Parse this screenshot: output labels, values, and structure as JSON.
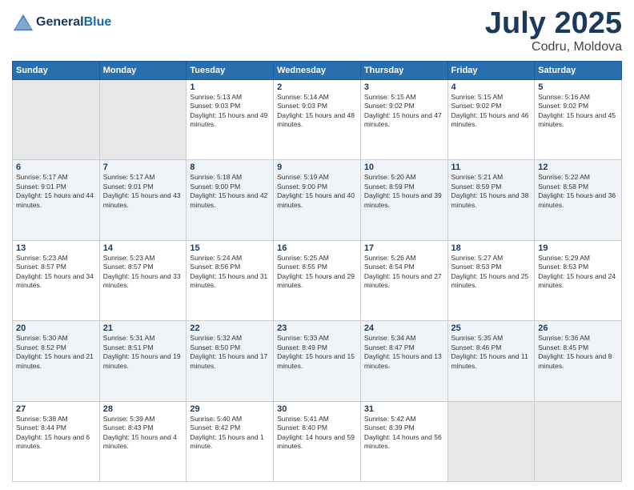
{
  "header": {
    "logo_general": "General",
    "logo_blue": "Blue",
    "month_year": "July 2025",
    "location": "Codru, Moldova"
  },
  "days_of_week": [
    "Sunday",
    "Monday",
    "Tuesday",
    "Wednesday",
    "Thursday",
    "Friday",
    "Saturday"
  ],
  "weeks": [
    [
      {
        "day": "",
        "info": ""
      },
      {
        "day": "",
        "info": ""
      },
      {
        "day": "1",
        "info": "Sunrise: 5:13 AM\nSunset: 9:03 PM\nDaylight: 15 hours and 49 minutes."
      },
      {
        "day": "2",
        "info": "Sunrise: 5:14 AM\nSunset: 9:03 PM\nDaylight: 15 hours and 48 minutes."
      },
      {
        "day": "3",
        "info": "Sunrise: 5:15 AM\nSunset: 9:02 PM\nDaylight: 15 hours and 47 minutes."
      },
      {
        "day": "4",
        "info": "Sunrise: 5:15 AM\nSunset: 9:02 PM\nDaylight: 15 hours and 46 minutes."
      },
      {
        "day": "5",
        "info": "Sunrise: 5:16 AM\nSunset: 9:02 PM\nDaylight: 15 hours and 45 minutes."
      }
    ],
    [
      {
        "day": "6",
        "info": "Sunrise: 5:17 AM\nSunset: 9:01 PM\nDaylight: 15 hours and 44 minutes."
      },
      {
        "day": "7",
        "info": "Sunrise: 5:17 AM\nSunset: 9:01 PM\nDaylight: 15 hours and 43 minutes."
      },
      {
        "day": "8",
        "info": "Sunrise: 5:18 AM\nSunset: 9:00 PM\nDaylight: 15 hours and 42 minutes."
      },
      {
        "day": "9",
        "info": "Sunrise: 5:19 AM\nSunset: 9:00 PM\nDaylight: 15 hours and 40 minutes."
      },
      {
        "day": "10",
        "info": "Sunrise: 5:20 AM\nSunset: 8:59 PM\nDaylight: 15 hours and 39 minutes."
      },
      {
        "day": "11",
        "info": "Sunrise: 5:21 AM\nSunset: 8:59 PM\nDaylight: 15 hours and 38 minutes."
      },
      {
        "day": "12",
        "info": "Sunrise: 5:22 AM\nSunset: 8:58 PM\nDaylight: 15 hours and 36 minutes."
      }
    ],
    [
      {
        "day": "13",
        "info": "Sunrise: 5:23 AM\nSunset: 8:57 PM\nDaylight: 15 hours and 34 minutes."
      },
      {
        "day": "14",
        "info": "Sunrise: 5:23 AM\nSunset: 8:57 PM\nDaylight: 15 hours and 33 minutes."
      },
      {
        "day": "15",
        "info": "Sunrise: 5:24 AM\nSunset: 8:56 PM\nDaylight: 15 hours and 31 minutes."
      },
      {
        "day": "16",
        "info": "Sunrise: 5:25 AM\nSunset: 8:55 PM\nDaylight: 15 hours and 29 minutes."
      },
      {
        "day": "17",
        "info": "Sunrise: 5:26 AM\nSunset: 8:54 PM\nDaylight: 15 hours and 27 minutes."
      },
      {
        "day": "18",
        "info": "Sunrise: 5:27 AM\nSunset: 8:53 PM\nDaylight: 15 hours and 25 minutes."
      },
      {
        "day": "19",
        "info": "Sunrise: 5:29 AM\nSunset: 8:53 PM\nDaylight: 15 hours and 24 minutes."
      }
    ],
    [
      {
        "day": "20",
        "info": "Sunrise: 5:30 AM\nSunset: 8:52 PM\nDaylight: 15 hours and 21 minutes."
      },
      {
        "day": "21",
        "info": "Sunrise: 5:31 AM\nSunset: 8:51 PM\nDaylight: 15 hours and 19 minutes."
      },
      {
        "day": "22",
        "info": "Sunrise: 5:32 AM\nSunset: 8:50 PM\nDaylight: 15 hours and 17 minutes."
      },
      {
        "day": "23",
        "info": "Sunrise: 5:33 AM\nSunset: 8:49 PM\nDaylight: 15 hours and 15 minutes."
      },
      {
        "day": "24",
        "info": "Sunrise: 5:34 AM\nSunset: 8:47 PM\nDaylight: 15 hours and 13 minutes."
      },
      {
        "day": "25",
        "info": "Sunrise: 5:35 AM\nSunset: 8:46 PM\nDaylight: 15 hours and 11 minutes."
      },
      {
        "day": "26",
        "info": "Sunrise: 5:36 AM\nSunset: 8:45 PM\nDaylight: 15 hours and 8 minutes."
      }
    ],
    [
      {
        "day": "27",
        "info": "Sunrise: 5:38 AM\nSunset: 8:44 PM\nDaylight: 15 hours and 6 minutes."
      },
      {
        "day": "28",
        "info": "Sunrise: 5:39 AM\nSunset: 8:43 PM\nDaylight: 15 hours and 4 minutes."
      },
      {
        "day": "29",
        "info": "Sunrise: 5:40 AM\nSunset: 8:42 PM\nDaylight: 15 hours and 1 minute."
      },
      {
        "day": "30",
        "info": "Sunrise: 5:41 AM\nSunset: 8:40 PM\nDaylight: 14 hours and 59 minutes."
      },
      {
        "day": "31",
        "info": "Sunrise: 5:42 AM\nSunset: 8:39 PM\nDaylight: 14 hours and 56 minutes."
      },
      {
        "day": "",
        "info": ""
      },
      {
        "day": "",
        "info": ""
      }
    ]
  ]
}
